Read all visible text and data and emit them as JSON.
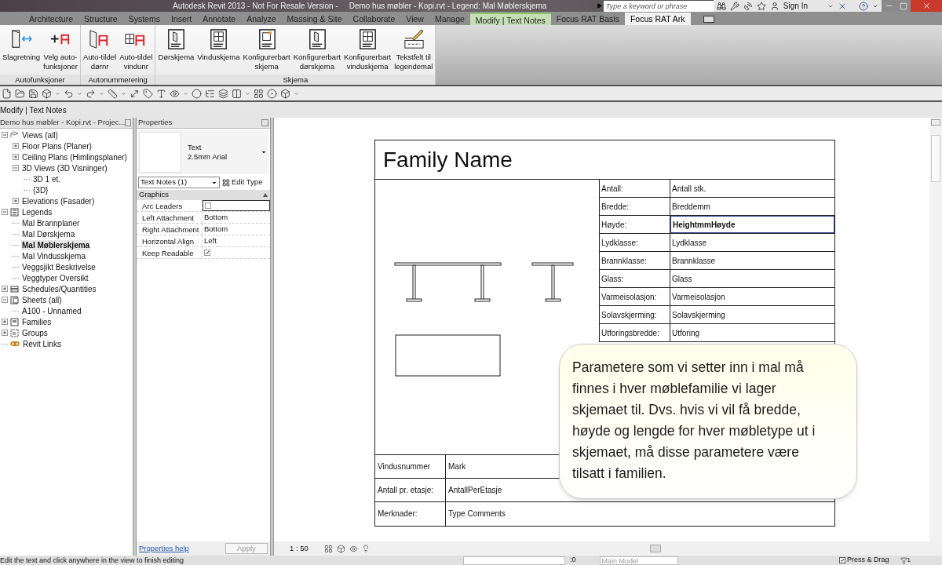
{
  "title_bar": {
    "app_title": "Autodesk Revit 2013 - Not For Resale Version -",
    "document_title": "Demo hus møbler - Kopi.rvt - Legend: Mal Møblerskjema",
    "search": {
      "placeholder": "Type a keyword or phrase"
    },
    "sign_in": "Sign In"
  },
  "ribbon_tabs": [
    {
      "label": "Architecture",
      "selected": false,
      "contextual": false
    },
    {
      "label": "Structure",
      "selected": false,
      "contextual": false
    },
    {
      "label": "Systems",
      "selected": false,
      "contextual": false
    },
    {
      "label": "Insert",
      "selected": false,
      "contextual": false
    },
    {
      "label": "Annotate",
      "selected": false,
      "contextual": false
    },
    {
      "label": "Analyze",
      "selected": false,
      "contextual": false
    },
    {
      "label": "Massing & Site",
      "selected": false,
      "contextual": false
    },
    {
      "label": "Collaborate",
      "selected": false,
      "contextual": false
    },
    {
      "label": "View",
      "selected": false,
      "contextual": false
    },
    {
      "label": "Manage",
      "selected": false,
      "contextual": false
    },
    {
      "label": "Modify | Text Notes",
      "selected": false,
      "contextual": true
    },
    {
      "label": "Focus RAT Basis",
      "selected": false,
      "contextual": false
    },
    {
      "label": "Focus RAT Ark",
      "selected": true,
      "contextual": false
    }
  ],
  "ribbon_panels": [
    {
      "label": "Autofunksjoner",
      "buttons": [
        "Slagretning",
        "Velg auto-\nfunksjoner"
      ]
    },
    {
      "label": "Autonummerering",
      "buttons": [
        "Auto-tildel\ndørnr",
        "Auto-tildel\nvindunr"
      ]
    },
    {
      "label": "Skjema",
      "buttons": [
        "Dørskjema",
        "Vinduskjema",
        "Konfigurerbart\nskjema",
        "Konfigurerbart\ndørskjema",
        "Konfigurerbart\nvinduskjema",
        "Tekstfelt til\nlegendemal"
      ]
    }
  ],
  "options_bar": {
    "context": "Modify | Text Notes"
  },
  "project_browser": {
    "title": "Demo hus møbler - Kopi.rvt - Projec...",
    "tree": [
      {
        "label": "Views (all)",
        "expanded": true,
        "selected": false,
        "children": [
          {
            "label": "Floor Plans (Planer)",
            "expanded": false,
            "selected": false
          },
          {
            "label": "Ceiling Plans (Himlingsplaner)",
            "expanded": false,
            "selected": false
          },
          {
            "label": "3D Views (3D Visninger)",
            "expanded": true,
            "selected": false,
            "children": [
              {
                "label": "3D 1 et.",
                "selected": false
              },
              {
                "label": "{3D}",
                "selected": false
              }
            ]
          },
          {
            "label": "Elevations (Fasader)",
            "expanded": false,
            "selected": false
          }
        ]
      },
      {
        "label": "Legends",
        "expanded": true,
        "selected": false,
        "children": [
          {
            "label": "Mal Brannplaner",
            "selected": false
          },
          {
            "label": "Mal Dørskjema",
            "selected": false
          },
          {
            "label": "Mal Møblerskjema",
            "selected": true
          },
          {
            "label": "Mal Vindusskjema",
            "selected": false
          },
          {
            "label": "Veggsjikt Beskrivelse",
            "selected": false
          },
          {
            "label": "Veggtyper Oversikt",
            "selected": false
          }
        ]
      },
      {
        "label": "Schedules/Quantities",
        "expanded": false,
        "selected": false
      },
      {
        "label": "Sheets (all)",
        "expanded": true,
        "selected": false,
        "children": [
          {
            "label": "A100 - Unnamed",
            "selected": false
          }
        ]
      },
      {
        "label": "Families",
        "expanded": false,
        "selected": false
      },
      {
        "label": "Groups",
        "expanded": false,
        "selected": false
      },
      {
        "label": "Revit Links",
        "selected": false
      }
    ]
  },
  "properties": {
    "title": "Properties",
    "type_name": "Text",
    "type_detail": "2.5mm Arial",
    "instance_selector": "Text Notes (1)",
    "edit_type": "Edit Type",
    "group": "Graphics",
    "rows": [
      {
        "label": "Arc Leaders",
        "kind": "checkbox",
        "checked": false,
        "active": true
      },
      {
        "label": "Left Attachment",
        "kind": "text",
        "value": "Bottom",
        "active": false
      },
      {
        "label": "Right Attachment",
        "kind": "text",
        "value": "Bottom",
        "active": false
      },
      {
        "label": "Horizontal Align",
        "kind": "text",
        "value": "Left",
        "active": false
      },
      {
        "label": "Keep Readable",
        "kind": "checkbox",
        "checked": true,
        "active": false
      }
    ],
    "help": "Properties help",
    "apply": {
      "label": "Apply",
      "disabled": true
    }
  },
  "view": {
    "schedule": {
      "family_name": "Family Name",
      "rows": [
        {
          "label": "Antall:",
          "value": "Antall stk.",
          "editing": false
        },
        {
          "label": "Bredde:",
          "value": "Breddemm",
          "editing": false
        },
        {
          "label": "Høyde:",
          "value": "HeightmmHøyde",
          "editing": true
        },
        {
          "label": "Lydklasse:",
          "value": "Lydklasse",
          "editing": false
        },
        {
          "label": "Brannklasse:",
          "value": "Brannklasse",
          "editing": false
        },
        {
          "label": "Glass:",
          "value": "Glass",
          "editing": false
        },
        {
          "label": "Varmeisolasjon:",
          "value": "Varmeisolasjon",
          "editing": false
        },
        {
          "label": "Solavskjerming:",
          "value": "Solavskjerming",
          "editing": false
        },
        {
          "label": "Utforingsbredde:",
          "value": "Utforing",
          "editing": false
        }
      ],
      "footer_rows": [
        {
          "label": "Vindusnummer",
          "value": "Mark"
        },
        {
          "label": "Antall pr. etasje:",
          "value": "AntallPerEtasje"
        },
        {
          "label": "Merknader:",
          "value": "Type Comments"
        }
      ]
    },
    "scale": "1 : 50"
  },
  "callout": "Parametere som vi setter inn i mal må finnes i hver møblefamilie vi lager skjemaet til. Dvs. hvis vi vil få bredde, høyde og lengde for hver møbletype ut i skjemaet, må disse parametere være tilsatt i familien.",
  "status_bar": {
    "message": "Edit the text and click anywhere in the view to finish editing",
    "selection_count": ":0",
    "workset": "Main Model",
    "press_drag": {
      "label": "Press & Drag",
      "checked": true
    },
    "filter_count": "1"
  }
}
